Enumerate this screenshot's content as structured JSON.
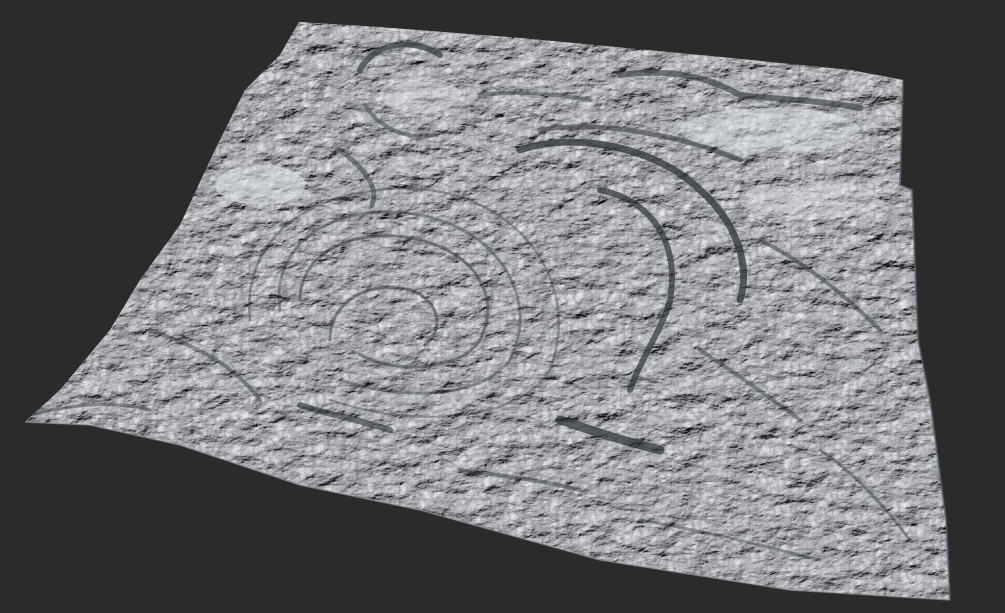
{
  "scene": {
    "background_color": "#2b2b2b",
    "terrain_base_color": "#c9ccd1",
    "terrain_highlight_color": "#e4e7ea",
    "terrain_shadow_color": "#3a3e45",
    "subject": "heightfield-terrain-render"
  }
}
